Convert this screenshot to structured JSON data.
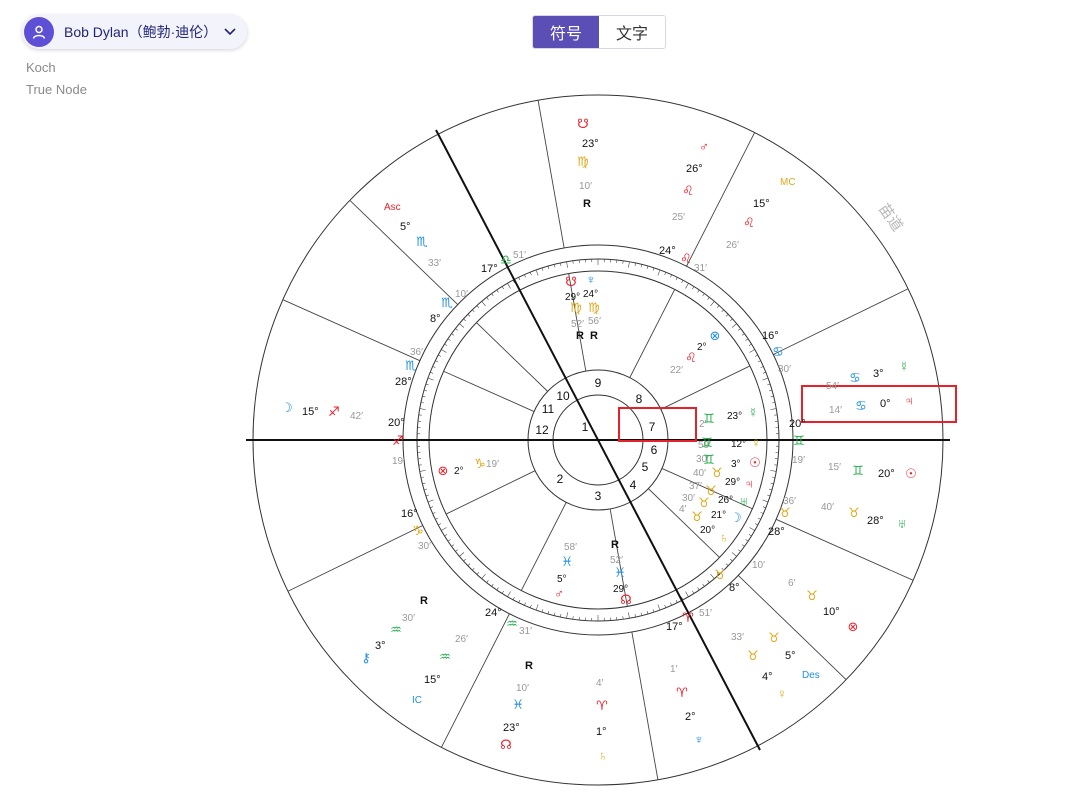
{
  "profile": {
    "name": "Bob Dylan（鲍勃·迪伦）"
  },
  "meta": {
    "house_system": "Koch",
    "node_type": "True Node"
  },
  "view_toggle": {
    "symbols": "符号",
    "text": "文字"
  },
  "wheel": {
    "corner_label": "苗道",
    "angles": [
      {
        "glyph": "Asc",
        "deg": "5°",
        "min": "33′"
      },
      {
        "glyph": "MC",
        "deg": "15°",
        "min": "26′"
      },
      {
        "glyph": "Des",
        "deg": "5°",
        "min": "33′"
      },
      {
        "glyph": "IC",
        "deg": "15°",
        "min": "26′"
      }
    ],
    "house_numbers": [
      "1",
      "2",
      "3",
      "4",
      "5",
      "6",
      "7",
      "8",
      "9",
      "10",
      "11",
      "12"
    ],
    "cusps": [
      {
        "deg": "20°",
        "min": "19′"
      },
      {
        "deg": "16°",
        "min": "30′"
      },
      {
        "deg": "24°",
        "min": "31′"
      },
      {
        "deg": "17°",
        "min": "51′"
      },
      {
        "deg": "8°",
        "min": "10′"
      },
      {
        "deg": "28°",
        "min": "36′"
      },
      {
        "deg": "20°",
        "min": "19′"
      },
      {
        "deg": "16°",
        "min": "30′"
      },
      {
        "deg": "24°",
        "min": "31′"
      },
      {
        "deg": "17°",
        "min": "51′"
      },
      {
        "deg": "8°",
        "min": "10′"
      },
      {
        "deg": "28°",
        "min": "36′"
      }
    ],
    "outer": [
      {
        "deg": "23°",
        "min": "10′",
        "retro": "R"
      },
      {
        "deg": "26°",
        "min": "25′"
      },
      {
        "deg": "3°",
        "min": "54′"
      },
      {
        "deg": "0°",
        "min": "14′"
      },
      {
        "deg": "20°",
        "min": "15′"
      },
      {
        "deg": "28°",
        "min": "40′"
      },
      {
        "deg": "10°",
        "min": "6′"
      },
      {
        "deg": "4°",
        "min": "1′"
      },
      {
        "deg": "2°",
        "min": "1′"
      },
      {
        "deg": "1°",
        "min": "4′"
      },
      {
        "deg": "23°",
        "min": "10′",
        "retro": "R"
      },
      {
        "deg": "3°",
        "min": "30′",
        "retro": "R"
      },
      {
        "deg": "15°",
        "min": "42′"
      }
    ],
    "inner": [
      {
        "deg": "29°",
        "min": "52′",
        "retro": "R"
      },
      {
        "deg": "24°",
        "min": "56′",
        "retro": "R"
      },
      {
        "deg": "2°",
        "min": "22′"
      },
      {
        "deg": "23°",
        "min": "2′"
      },
      {
        "deg": "12°",
        "min": "59′"
      },
      {
        "deg": "3°",
        "min": "30′"
      },
      {
        "deg": "29°",
        "min": "40′"
      },
      {
        "deg": "26°",
        "min": "37′"
      },
      {
        "deg": "21°",
        "min": "30′"
      },
      {
        "deg": "20°",
        "min": "4′"
      },
      {
        "deg": "29°",
        "min": "52′",
        "retro": "R"
      },
      {
        "deg": "5°",
        "min": "58′",
        "retro": "R"
      },
      {
        "deg": "2°",
        "min": "19′"
      }
    ],
    "colors": {
      "fire": "#e8202a",
      "earth": "#e0a81a",
      "air": "#22b04a",
      "water": "#1e8fe0",
      "highlight": "#e8202a"
    }
  }
}
